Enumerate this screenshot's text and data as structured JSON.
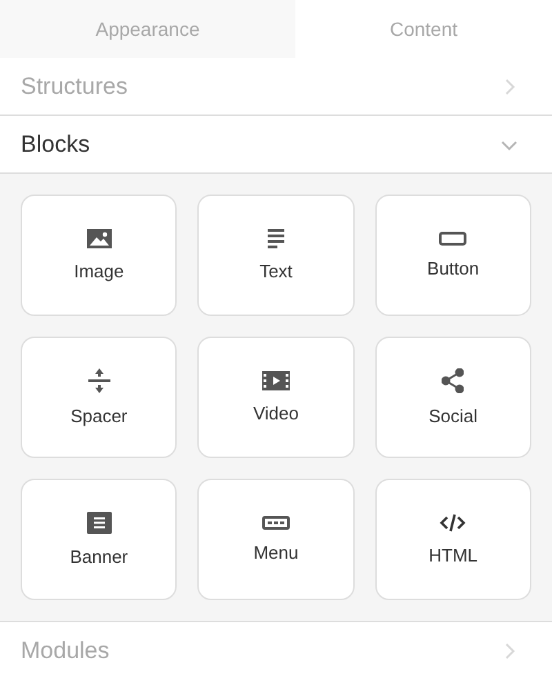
{
  "tabs": [
    {
      "label": "Appearance",
      "selected": false
    },
    {
      "label": "Content",
      "selected": true
    }
  ],
  "sections": [
    {
      "title": "Structures",
      "expanded": false,
      "disabled": true
    },
    {
      "title": "Blocks",
      "expanded": true,
      "disabled": false,
      "blocks": [
        {
          "label": "Image",
          "kind": "image"
        },
        {
          "label": "Text",
          "kind": "text"
        },
        {
          "label": "Button",
          "kind": "button"
        },
        {
          "label": "Spacer",
          "kind": "spacer"
        },
        {
          "label": "Video",
          "kind": "video"
        },
        {
          "label": "Social",
          "kind": "social"
        },
        {
          "label": "Banner",
          "kind": "banner"
        },
        {
          "label": "Menu",
          "kind": "menu"
        },
        {
          "label": "HTML",
          "kind": "html"
        }
      ]
    },
    {
      "title": "Modules",
      "expanded": false,
      "disabled": true
    }
  ]
}
